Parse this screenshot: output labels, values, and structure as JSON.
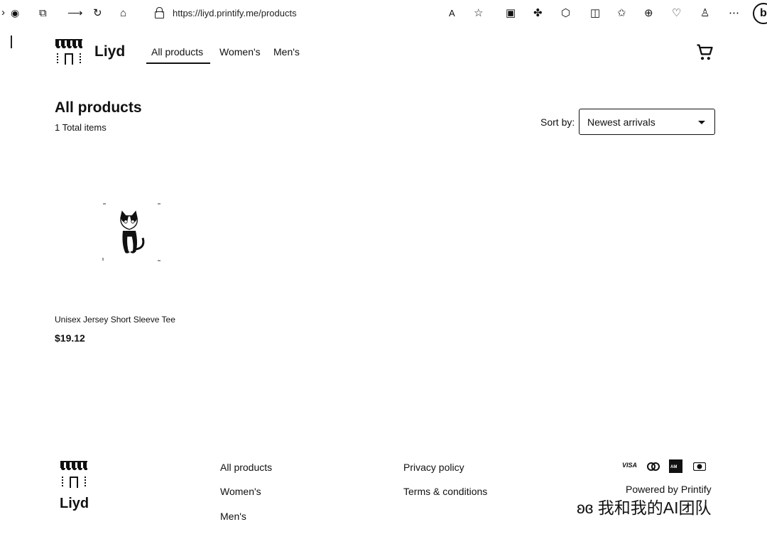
{
  "browser": {
    "url": "https://liyd.printify.me/products",
    "profile_initial": "b"
  },
  "header": {
    "brand": "Liyd",
    "nav": [
      {
        "label": "All products",
        "active": true
      },
      {
        "label": "Women's",
        "active": false
      },
      {
        "label": "Men's",
        "active": false
      }
    ],
    "cart_icon": "shopping-cart-icon"
  },
  "main": {
    "title": "All products",
    "total_items": "1 Total items",
    "sort_label": "Sort by:",
    "sort_value": "Newest arrivals"
  },
  "products": [
    {
      "name": "Unisex Jersey Short Sleeve Tee",
      "price": "$19.12",
      "image_icon": "cat-tee-image"
    }
  ],
  "footer": {
    "brand": "Liyd",
    "links_col1": [
      "All products",
      "Women's",
      "Men's"
    ],
    "links_col2": [
      "Privacy policy",
      "Terms & conditions"
    ],
    "payment_methods": [
      "VISA",
      "Mastercard",
      "AMEX",
      "Diners"
    ],
    "powered_by": "Powered by Printify"
  },
  "watermark": "我和我的AI团队"
}
